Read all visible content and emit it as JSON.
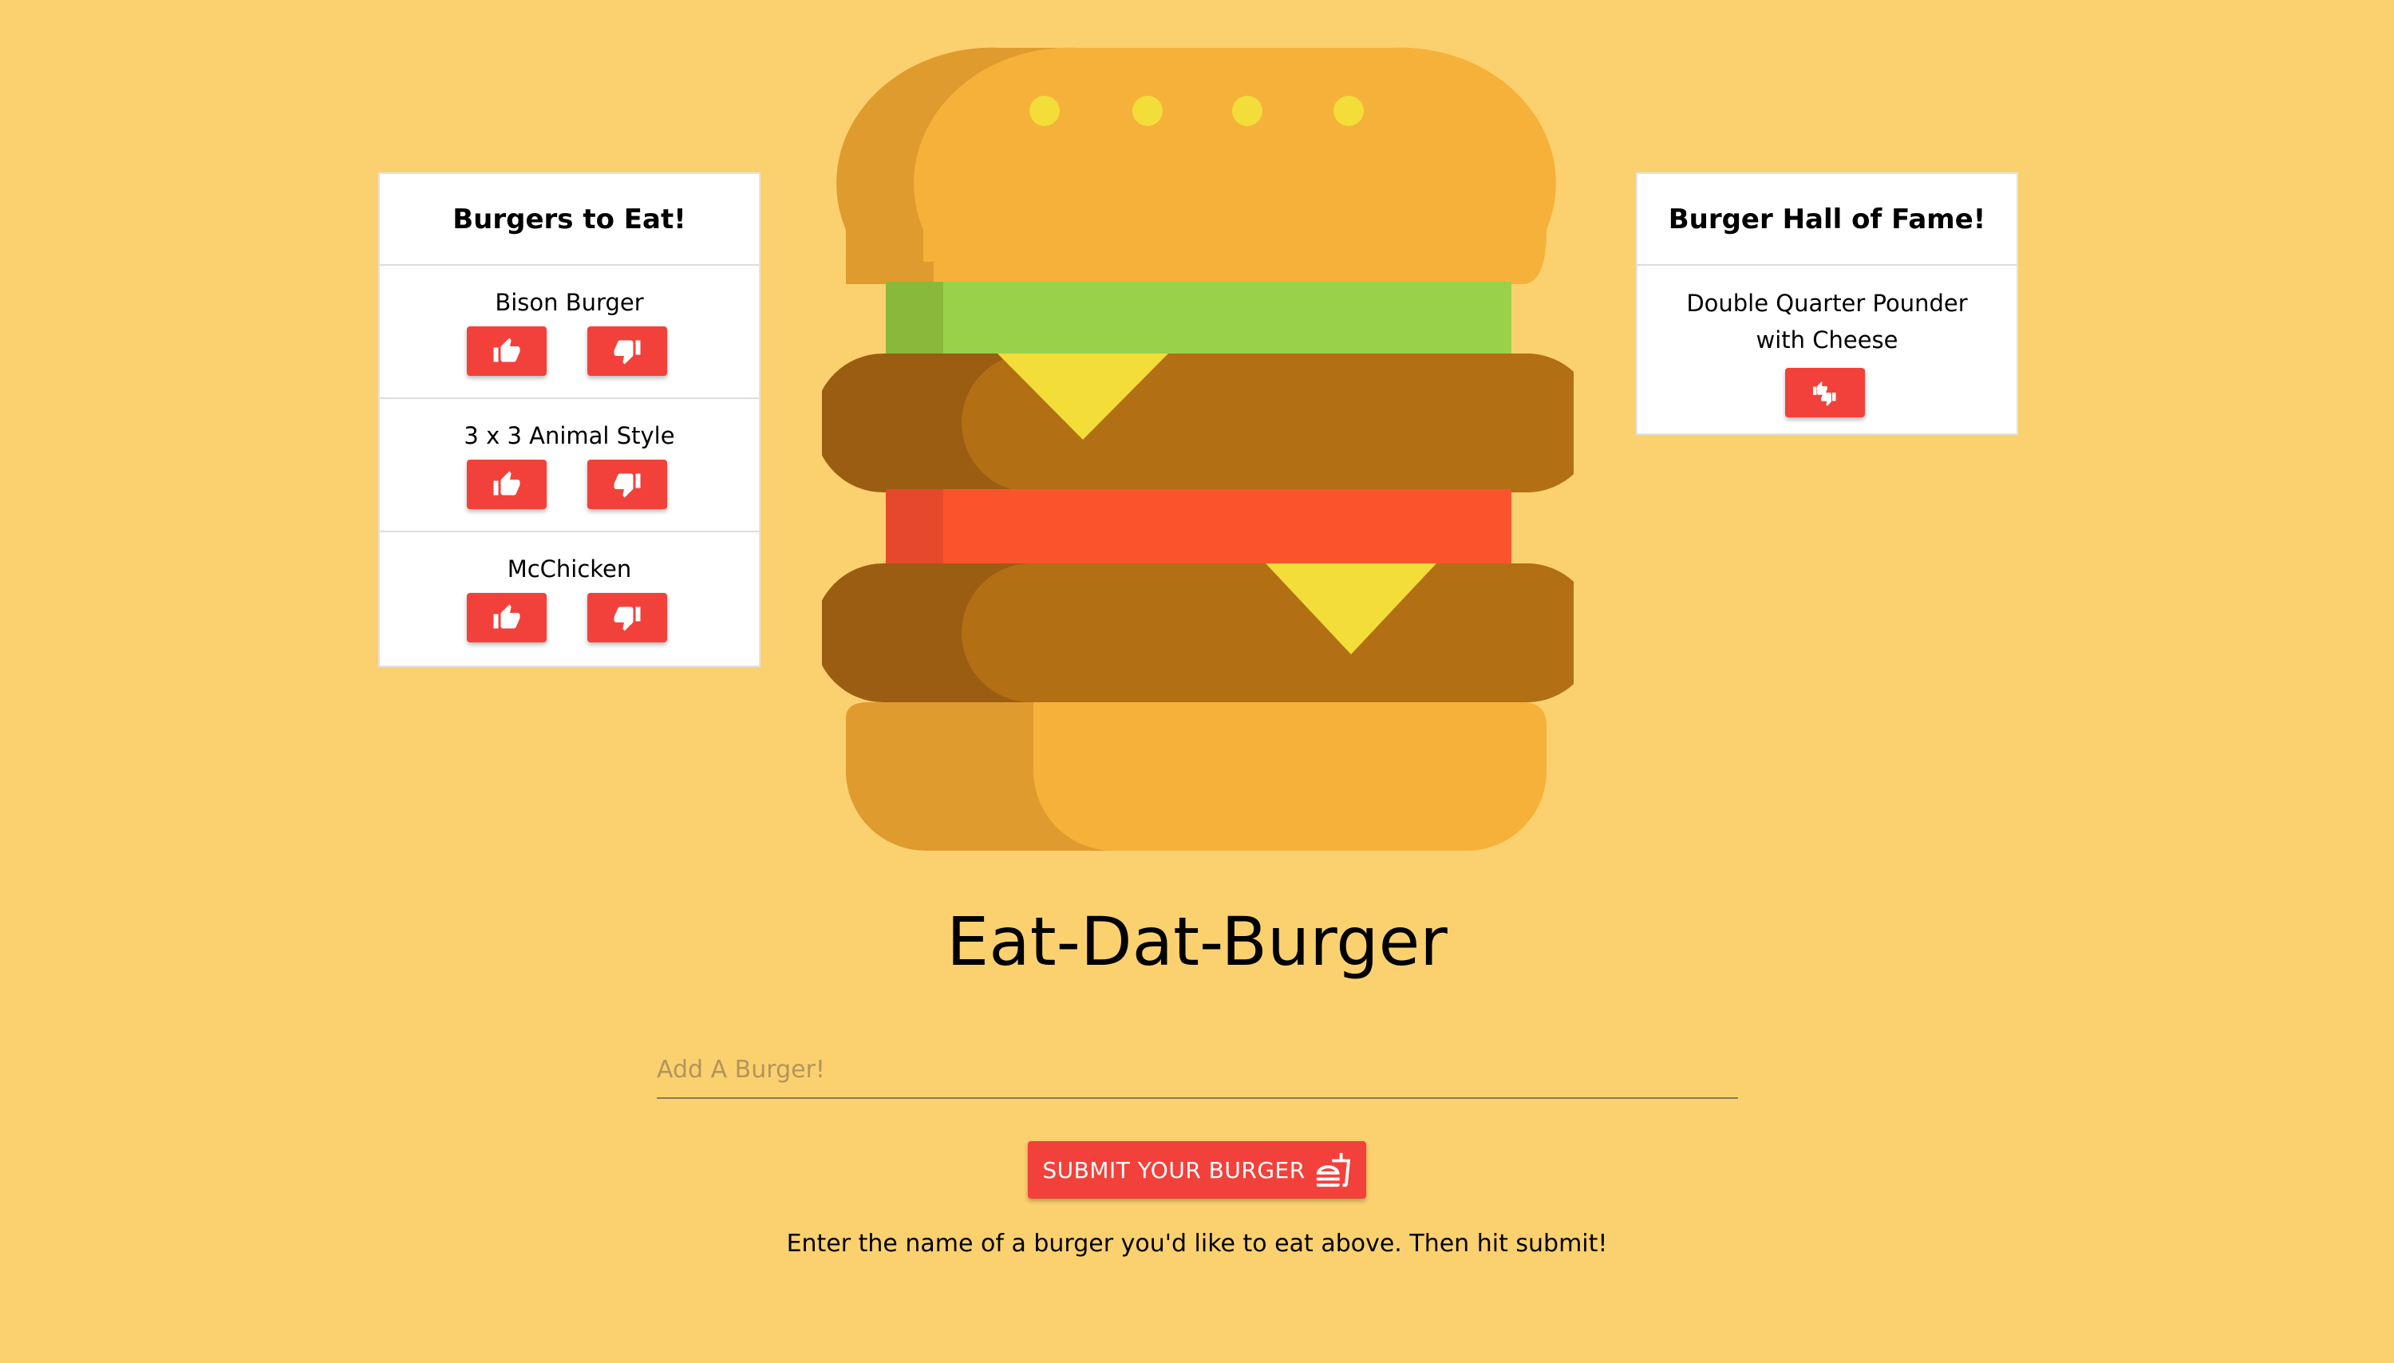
{
  "to_eat": {
    "title": "Burgers to Eat!",
    "items": [
      {
        "name": "Bison Burger"
      },
      {
        "name": "3 x 3 Animal Style"
      },
      {
        "name": "McChicken"
      }
    ]
  },
  "hall_of_fame": {
    "title": "Burger Hall of Fame!",
    "items": [
      {
        "name": "Double Quarter Pounder with Cheese"
      }
    ]
  },
  "app_title": "Eat-Dat-Burger",
  "form": {
    "placeholder": "Add A Burger!",
    "submit_label": "SUBMIT YOUR BURGER",
    "hint": "Enter the name of a burger you'd like to eat above. Then hit submit!"
  },
  "icons": {
    "devour": "thumbs-up-icon",
    "reject": "thumbs-down-icon",
    "undo": "thumbs-swap-icon",
    "submit": "hamburger-soda-icon",
    "hero": "burger-illustration"
  },
  "colors": {
    "background": "#fbd16f",
    "button": "#f2413b",
    "bun_light": "#f6b13b",
    "bun_dark": "#df9b2d",
    "lettuce": "#99d24a",
    "patty": "#b26f14",
    "tomato": "#fb542d",
    "cheese": "#f3dd39"
  }
}
